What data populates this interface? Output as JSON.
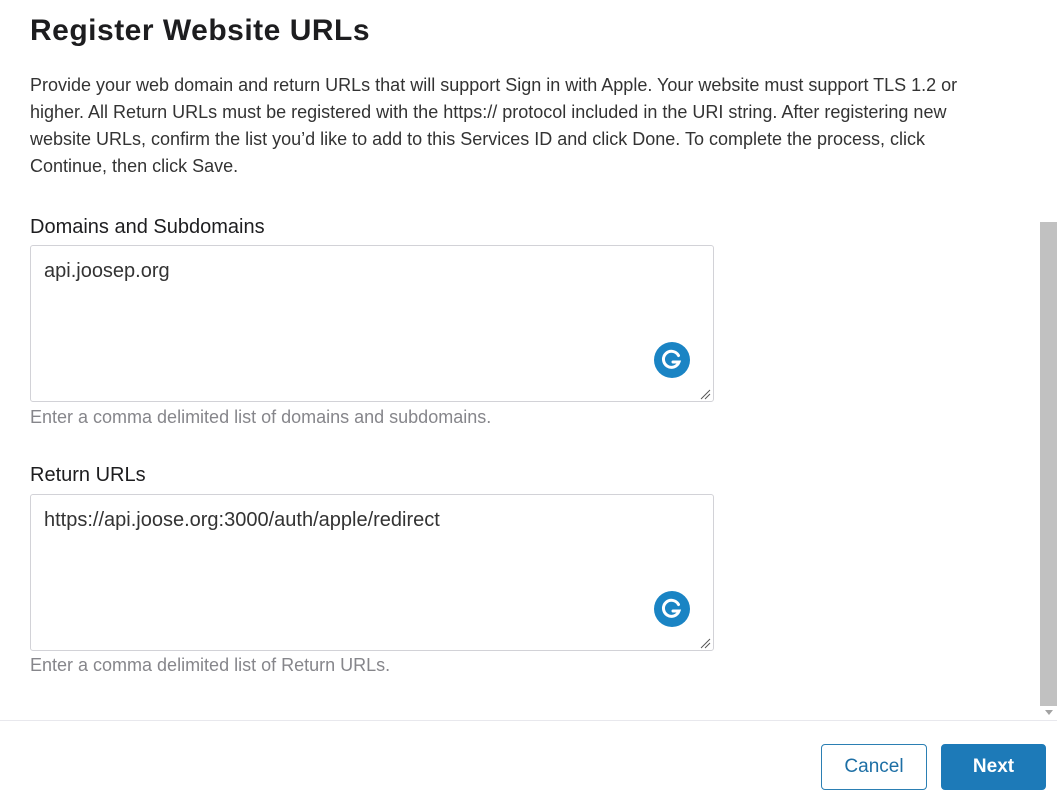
{
  "page": {
    "title": "Register Website URLs",
    "description": "Provide your web domain and return URLs that will support Sign in with Apple. Your website must support TLS 1.2 or higher. All Return URLs must be registered with the https:// protocol included in the URI string. After registering new website URLs, confirm the list you’d like to add to this Services ID and click Done. To complete the process, click Continue, then click Save."
  },
  "domains": {
    "label": "Domains and Subdomains",
    "value": "api.joosep.org",
    "hint": "Enter a comma delimited list of domains and subdomains.",
    "icon": "grammarly-icon"
  },
  "return_urls": {
    "label": "Return URLs",
    "value": "https://api.joose.org:3000/auth/apple/redirect",
    "hint": "Enter a comma delimited list of Return URLs.",
    "icon": "grammarly-icon"
  },
  "footer": {
    "cancel_label": "Cancel",
    "next_label": "Next"
  },
  "colors": {
    "accent": "#1d7ab8",
    "hint_text": "#86868b",
    "grammarly": "#1a84c4"
  }
}
